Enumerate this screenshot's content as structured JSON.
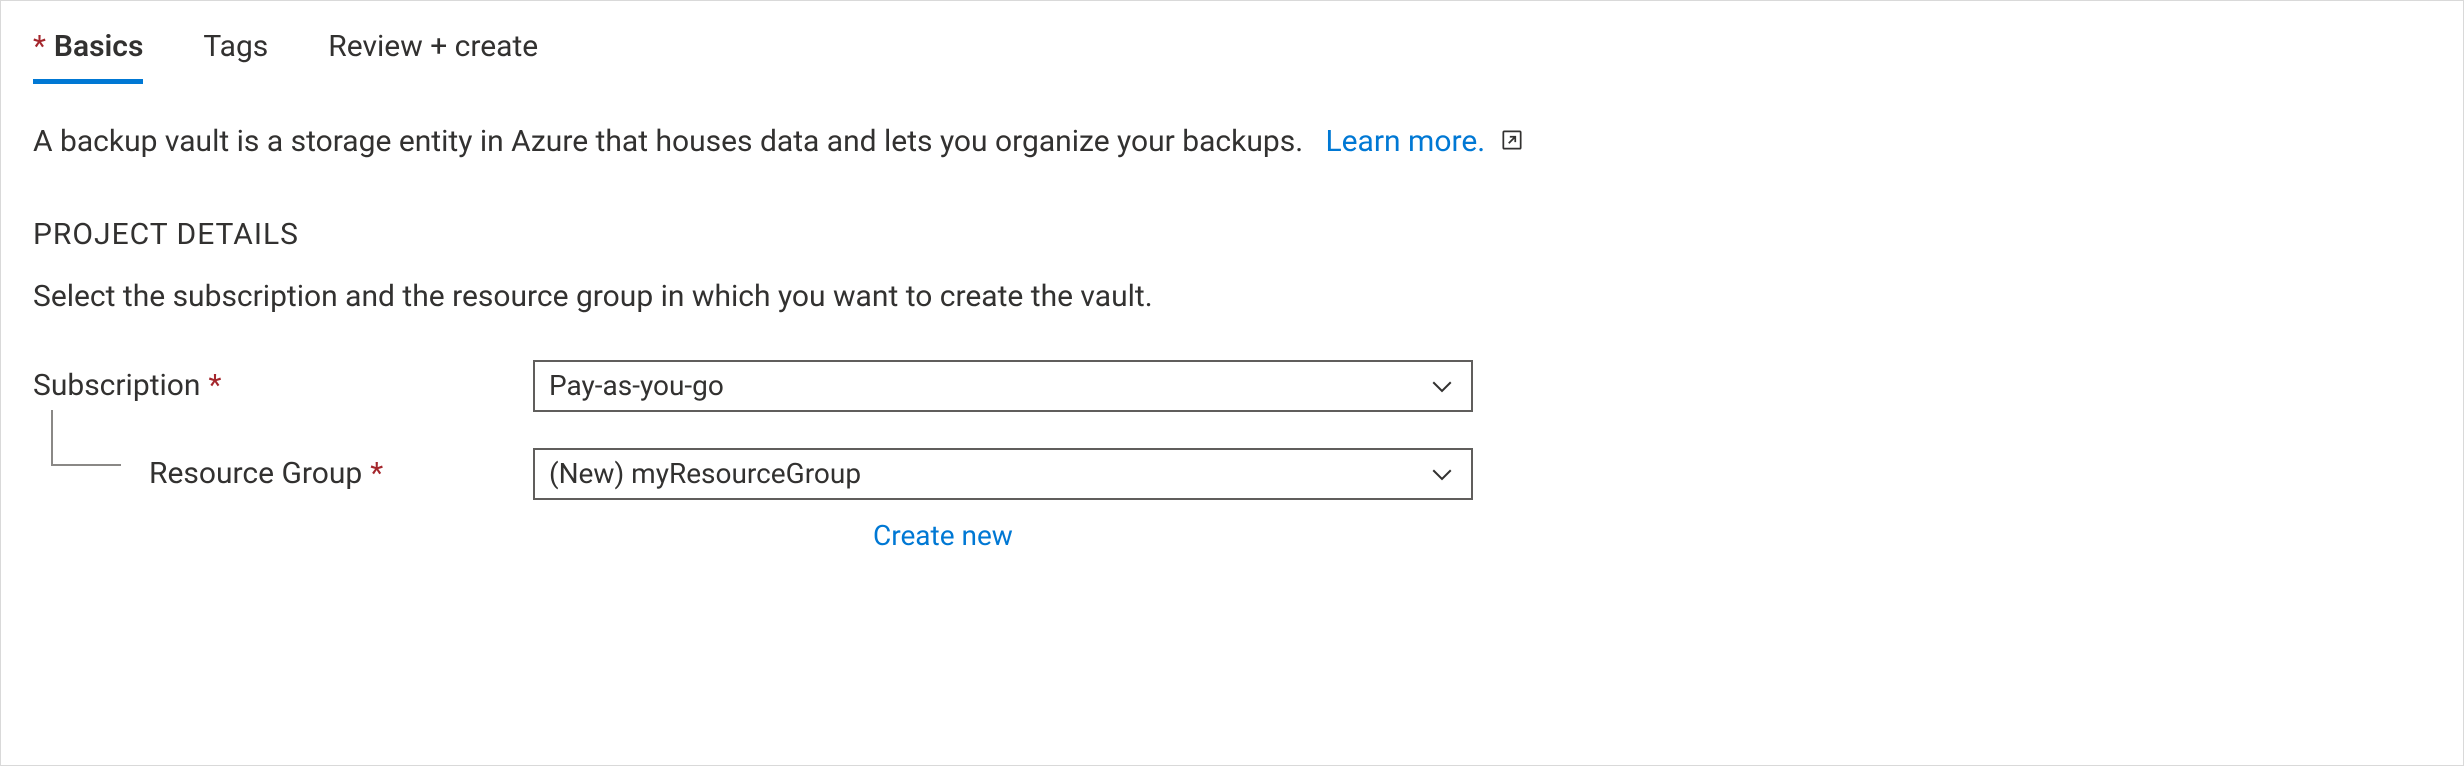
{
  "tabs": {
    "basics": "Basics",
    "tags": "Tags",
    "review": "Review + create"
  },
  "intro": {
    "text": "A backup vault is a storage entity in Azure that houses data and lets you organize your backups.",
    "learn_more": "Learn more."
  },
  "section": {
    "project_details_heading": "PROJECT DETAILS",
    "project_details_desc": "Select the subscription and the resource group in which you want to create the vault."
  },
  "fields": {
    "subscription": {
      "label": "Subscription",
      "value": "Pay-as-you-go"
    },
    "resource_group": {
      "label": "Resource Group",
      "value": "(New) myResourceGroup",
      "create_new": "Create new"
    }
  }
}
